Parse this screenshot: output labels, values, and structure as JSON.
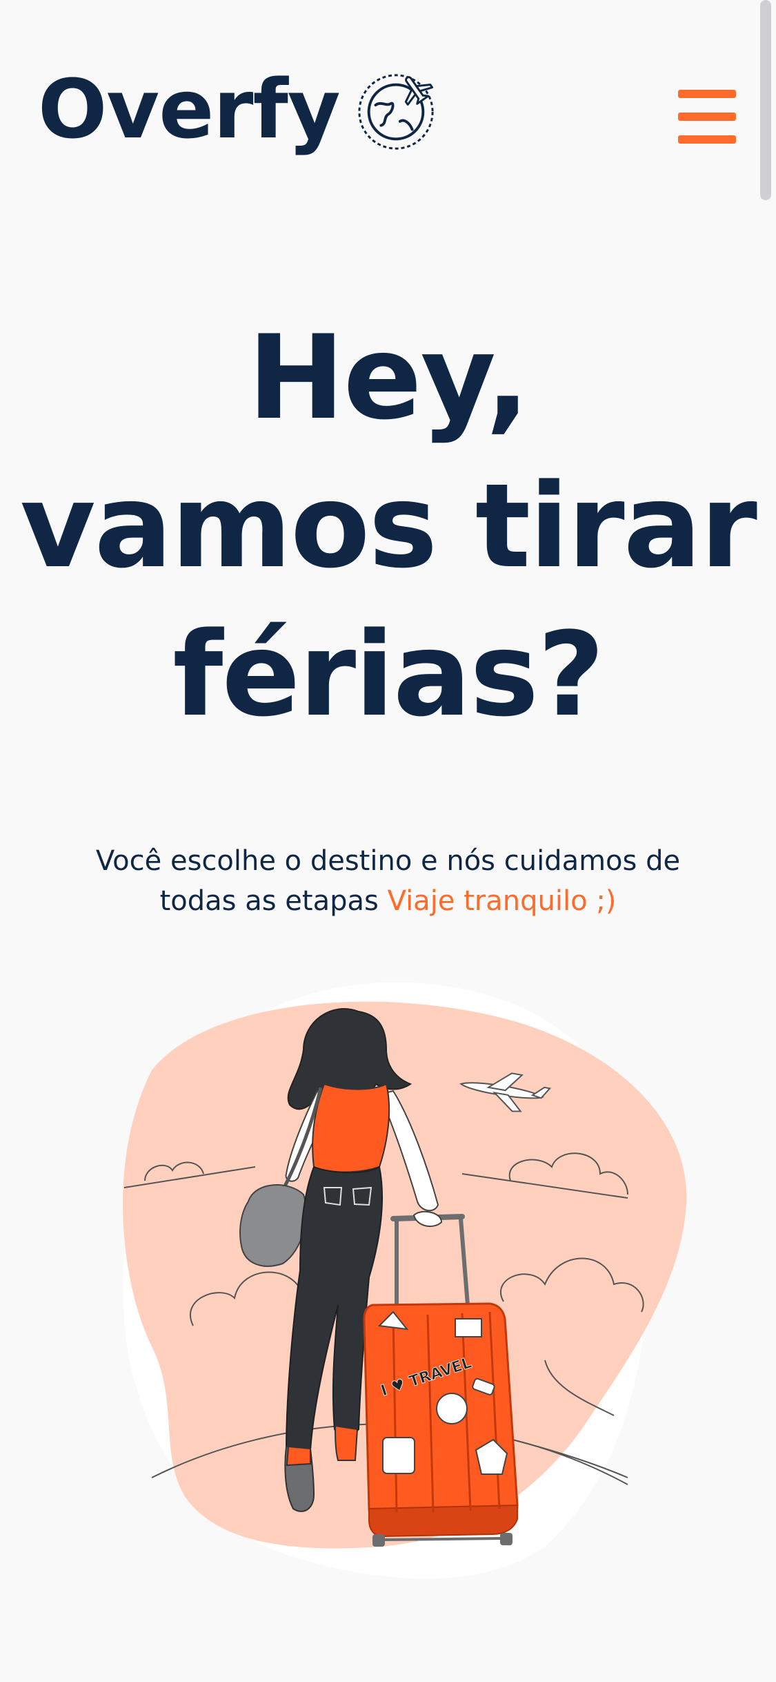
{
  "header": {
    "logo_text": "Overfy",
    "logo_icon": "globe-airplane-icon",
    "menu_icon": "hamburger-menu-icon"
  },
  "hero": {
    "title_lines": [
      "Hey,",
      "vamos tirar",
      "férias?"
    ],
    "subtitle_line1": "Você escolhe o destino e nós cuidamos de",
    "subtitle_line2": "todas as etapas",
    "subtitle_accent": "Viaje tranquilo ;)"
  },
  "illustration": {
    "name": "woman-with-suitcase-illustration",
    "sticker_text": "I ♥ TRAVEL"
  },
  "colors": {
    "primary": "#0f2744",
    "accent": "#ff6b2b",
    "background": "#f9f9fa",
    "blob": "#ffd0bd"
  }
}
